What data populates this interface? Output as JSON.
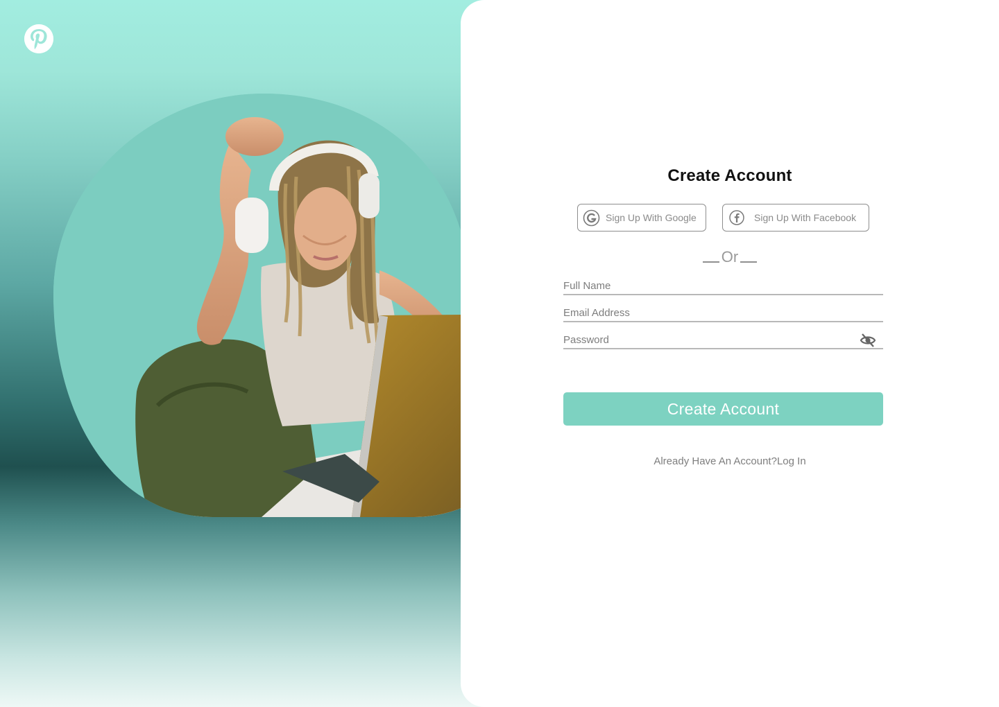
{
  "colors": {
    "accent": "#7dd2c1",
    "hero_top": "#a2ede0",
    "hero_dark": "#1f504f",
    "text_dark": "#111111",
    "text_muted": "#7e7e7e"
  },
  "brand": {
    "logo_icon": "pinterest-icon"
  },
  "hero": {
    "photo": "person-with-headphones-and-laptop"
  },
  "form": {
    "title": "Create Account",
    "google_label": "Sign Up With Google",
    "google_icon": "google-icon",
    "facebook_label": "Sign Up With Facebook",
    "facebook_icon": "facebook-icon",
    "divider_text": "Or",
    "full_name_placeholder": "Full Name",
    "email_placeholder": "Email Address",
    "password_placeholder": "Password",
    "password_toggle_icon": "eye-off-icon",
    "submit_label": "Create Account",
    "login_prompt": "Already Have An Account?",
    "login_link": "Log In"
  }
}
